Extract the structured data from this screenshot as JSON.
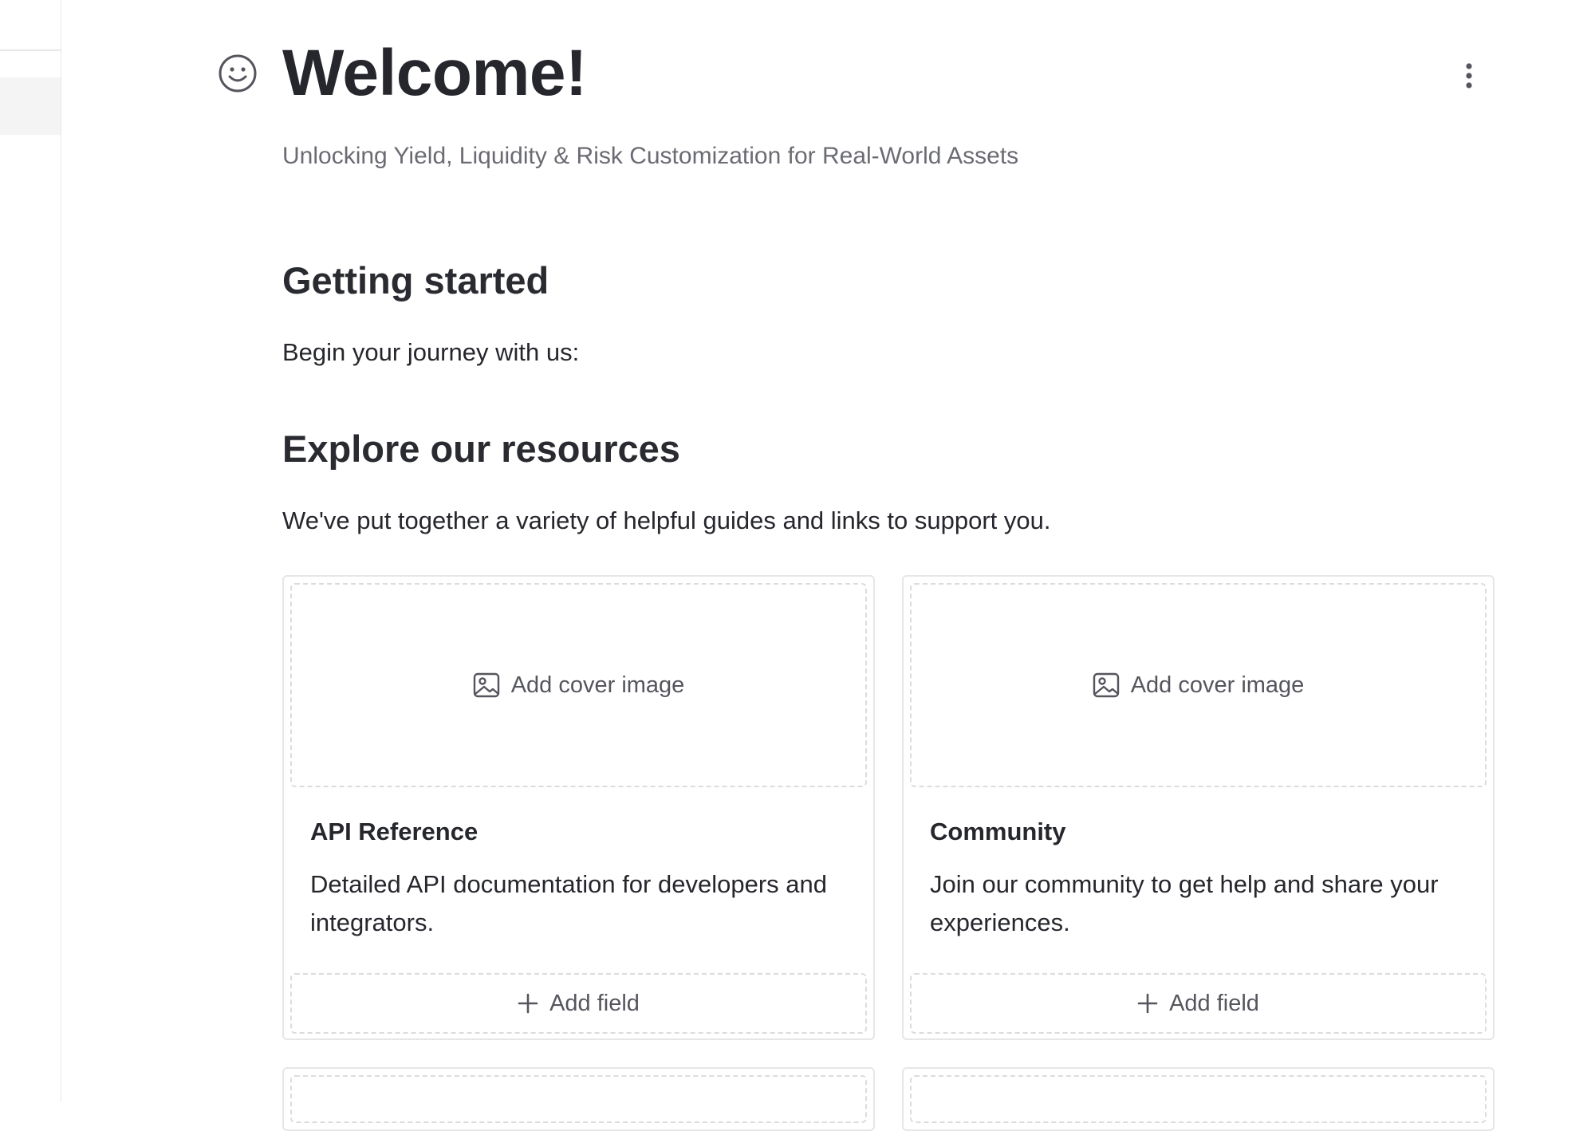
{
  "page": {
    "title": "Welcome!",
    "subtitle": "Unlocking Yield, Liquidity & Risk Customization for Real-World Assets",
    "icon": "smiley-face-icon"
  },
  "sections": {
    "getting_started": {
      "heading": "Getting started",
      "text": "Begin your journey with us:"
    },
    "explore": {
      "heading": "Explore our resources",
      "text": "We've put together a variety of helpful guides and links to support you."
    }
  },
  "cards": [
    {
      "cover_label": "Add cover image",
      "title": "API Reference",
      "description": "Detailed API documentation for developers and integrators.",
      "add_field_label": "Add field"
    },
    {
      "cover_label": "Add cover image",
      "title": "Community",
      "description": "Join our community to get help and share your experiences.",
      "add_field_label": "Add field"
    }
  ],
  "colors": {
    "text": "#26272d",
    "muted": "#6b6c73",
    "border": "#e6e6e8",
    "dashed": "#dcdcdf"
  }
}
